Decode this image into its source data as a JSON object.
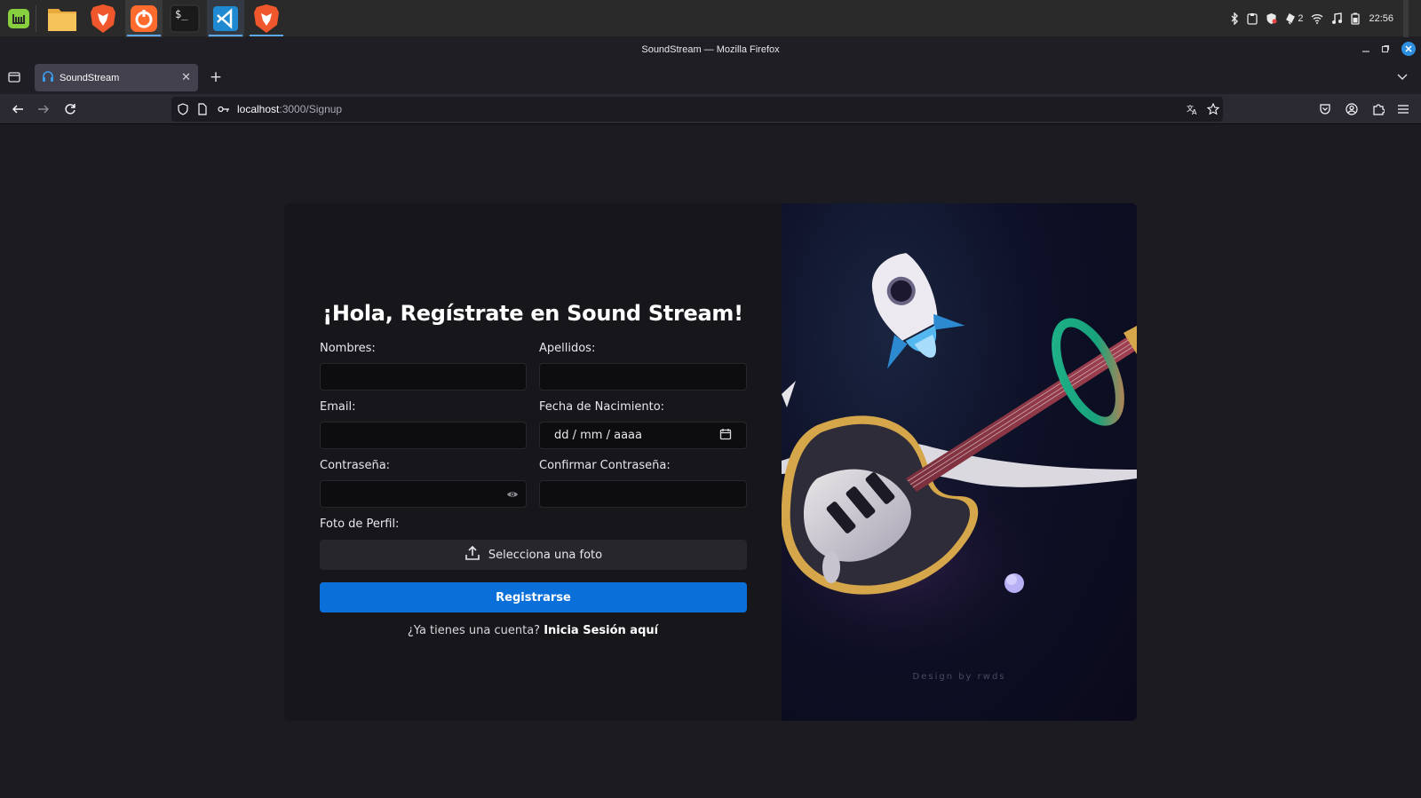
{
  "taskbar": {
    "launchers": [
      "mint-menu",
      "files",
      "brave",
      "firefox",
      "terminal",
      "vscode",
      "brave"
    ],
    "tray_badge_count": "2",
    "clock": "22:56"
  },
  "window": {
    "title": "SoundStream — Mozilla Firefox"
  },
  "tabs": [
    {
      "title": "SoundStream",
      "icon": "headphones-icon",
      "active": true
    }
  ],
  "address_bar": {
    "host": "localhost",
    "path": ":3000/Signup"
  },
  "form": {
    "heading": "¡Hola, Regístrate en Sound Stream!",
    "fields": {
      "first_name": {
        "label": "Nombres:",
        "value": ""
      },
      "last_name": {
        "label": "Apellidos:",
        "value": ""
      },
      "email": {
        "label": "Email:",
        "value": ""
      },
      "birth_date": {
        "label": "Fecha de Nacimiento:",
        "placeholder": "dd / mm / aaaa"
      },
      "password": {
        "label": "Contraseña:",
        "value": ""
      },
      "confirm_password": {
        "label": "Confirmar Contraseña:",
        "value": ""
      },
      "photo": {
        "label": "Foto de Perfil:",
        "button": "Selecciona una foto"
      }
    },
    "submit_label": "Registrarse",
    "login_prompt": "¿Ya tienes una cuenta?",
    "login_link": "Inicia Sesión aquí"
  },
  "artwork": {
    "credit": "Design by rwds"
  },
  "colors": {
    "accent": "#0b6fd9",
    "page_bg": "#1c1b22",
    "card_bg": "#17171b",
    "input_bg": "#0d0d10"
  }
}
